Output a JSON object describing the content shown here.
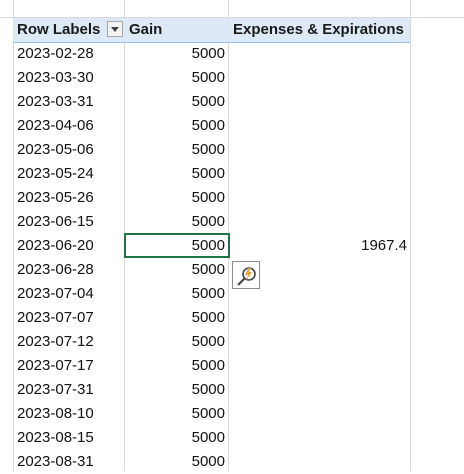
{
  "pivot": {
    "headers": {
      "row_labels": "Row Labels",
      "gain": "Gain",
      "expenses": "Expenses & Expirations"
    },
    "rows": [
      {
        "date": "2023-02-28",
        "gain": "5000",
        "expenses": ""
      },
      {
        "date": "2023-03-30",
        "gain": "5000",
        "expenses": ""
      },
      {
        "date": "2023-03-31",
        "gain": "5000",
        "expenses": ""
      },
      {
        "date": "2023-04-06",
        "gain": "5000",
        "expenses": ""
      },
      {
        "date": "2023-05-06",
        "gain": "5000",
        "expenses": ""
      },
      {
        "date": "2023-05-24",
        "gain": "5000",
        "expenses": ""
      },
      {
        "date": "2023-05-26",
        "gain": "5000",
        "expenses": ""
      },
      {
        "date": "2023-06-15",
        "gain": "5000",
        "expenses": ""
      },
      {
        "date": "2023-06-20",
        "gain": "5000",
        "expenses": "1967.4"
      },
      {
        "date": "2023-06-28",
        "gain": "5000",
        "expenses": ""
      },
      {
        "date": "2023-07-04",
        "gain": "5000",
        "expenses": ""
      },
      {
        "date": "2023-07-07",
        "gain": "5000",
        "expenses": ""
      },
      {
        "date": "2023-07-12",
        "gain": "5000",
        "expenses": ""
      },
      {
        "date": "2023-07-17",
        "gain": "5000",
        "expenses": ""
      },
      {
        "date": "2023-07-31",
        "gain": "5000",
        "expenses": ""
      },
      {
        "date": "2023-08-10",
        "gain": "5000",
        "expenses": ""
      },
      {
        "date": "2023-08-15",
        "gain": "5000",
        "expenses": ""
      },
      {
        "date": "2023-08-31",
        "gain": "5000",
        "expenses": ""
      }
    ]
  },
  "icons": {
    "filter": "filter-dropdown-icon",
    "quick_analysis": "quick-analysis-icon"
  },
  "colors": {
    "header_fill": "#dde9f7",
    "selection_border": "#217346",
    "gridline": "#d9d9d9"
  }
}
